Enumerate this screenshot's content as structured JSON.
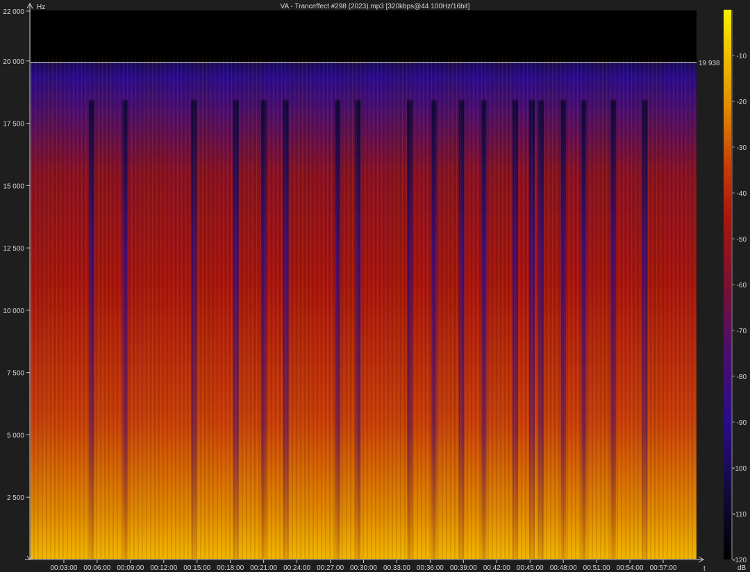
{
  "chart_data": {
    "type": "heatmap",
    "title": "VA - Tranceffect #298 (2023).mp3 [320kbps@44 100Hz/16bit]",
    "ylabel": "Hz",
    "xlabel": "t",
    "colorbar_label": "dB",
    "ylim": [
      0,
      22000
    ],
    "xlim_seconds": [
      0,
      3600
    ],
    "y_ticks": [
      {
        "value": 2500,
        "label": "2 500"
      },
      {
        "value": 5000,
        "label": "5 000"
      },
      {
        "value": 7500,
        "label": "7 500"
      },
      {
        "value": 10000,
        "label": "10 000"
      },
      {
        "value": 12500,
        "label": "12 500"
      },
      {
        "value": 15000,
        "label": "15 000"
      },
      {
        "value": 17500,
        "label": "17 500"
      },
      {
        "value": 20000,
        "label": "20 000"
      },
      {
        "value": 22000,
        "label": "22 000"
      }
    ],
    "x_ticks": [
      {
        "value": 180,
        "label": "00:03:00"
      },
      {
        "value": 360,
        "label": "00:06:00"
      },
      {
        "value": 540,
        "label": "00:09:00"
      },
      {
        "value": 720,
        "label": "00:12:00"
      },
      {
        "value": 900,
        "label": "00:15:00"
      },
      {
        "value": 1080,
        "label": "00:18:00"
      },
      {
        "value": 1260,
        "label": "00:21:00"
      },
      {
        "value": 1440,
        "label": "00:24:00"
      },
      {
        "value": 1620,
        "label": "00:27:00"
      },
      {
        "value": 1800,
        "label": "00:30:00"
      },
      {
        "value": 1980,
        "label": "00:33:00"
      },
      {
        "value": 2160,
        "label": "00:36:00"
      },
      {
        "value": 2340,
        "label": "00:39:00"
      },
      {
        "value": 2520,
        "label": "00:42:00"
      },
      {
        "value": 2700,
        "label": "00:45:00"
      },
      {
        "value": 2880,
        "label": "00:48:00"
      },
      {
        "value": 3060,
        "label": "00:51:00"
      },
      {
        "value": 3240,
        "label": "00:54:00"
      },
      {
        "value": 3420,
        "label": "00:57:00"
      }
    ],
    "cutoff": {
      "value": 19938,
      "label": "19 938"
    },
    "colorbar": {
      "range_db": [
        -120,
        0
      ],
      "ticks": [
        {
          "value": -10,
          "label": "-10"
        },
        {
          "value": -20,
          "label": "-20"
        },
        {
          "value": -30,
          "label": "-30"
        },
        {
          "value": -40,
          "label": "-40"
        },
        {
          "value": -50,
          "label": "-50"
        },
        {
          "value": -60,
          "label": "-60"
        },
        {
          "value": -70,
          "label": "-70"
        },
        {
          "value": -80,
          "label": "-80"
        },
        {
          "value": -90,
          "label": "-90"
        },
        {
          "value": -100,
          "label": "-100"
        },
        {
          "value": -110,
          "label": "-110"
        },
        {
          "value": -120,
          "label": "-120"
        }
      ],
      "stops": [
        "#000000",
        "#120a3a",
        "#2a0c8a",
        "#4b0f6e",
        "#7a1030",
        "#a8160e",
        "#c8400a",
        "#e08a00",
        "#f0c000",
        "#f5f000"
      ]
    },
    "quiet_gaps_seconds": [
      330,
      512,
      883,
      1110,
      1260,
      1380,
      1660,
      1770,
      2050,
      2180,
      2330,
      2450,
      2620,
      2710,
      2760,
      2880,
      2990,
      3150,
      3320
    ],
    "grid": false
  }
}
